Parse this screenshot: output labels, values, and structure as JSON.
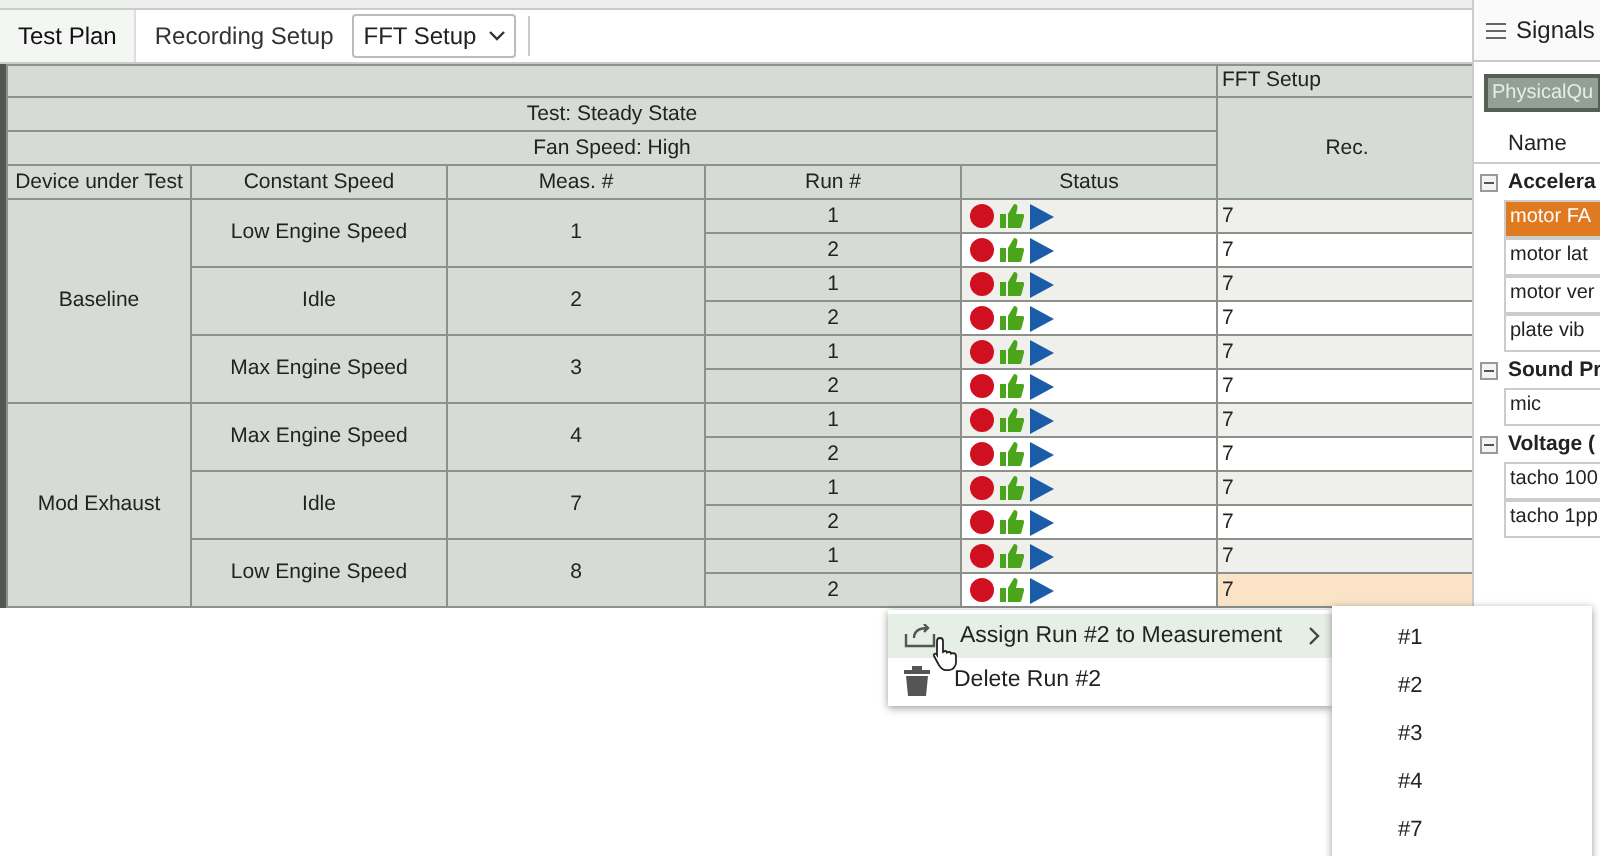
{
  "toolbar": {
    "tabs": [
      {
        "label": "Test Plan",
        "selected": true
      },
      {
        "label": "Recording Setup",
        "selected": false
      }
    ],
    "dropdown": {
      "value": "FFT Setup"
    }
  },
  "table": {
    "test_label": "Test: Steady State",
    "fan_label": "Fan Speed: High",
    "group_header": "FFT Setup",
    "rec_header": "Rec.",
    "columns": [
      "Device under Test",
      "Constant Speed",
      "Meas. #",
      "Run #",
      "Status"
    ],
    "devices": [
      {
        "name": "Baseline",
        "speeds": [
          {
            "name": "Low Engine Speed",
            "meas": "1",
            "runs": [
              {
                "run": "1",
                "rec": "7",
                "selected": false
              },
              {
                "run": "2",
                "rec": "7",
                "selected": false
              }
            ]
          },
          {
            "name": "Idle",
            "meas": "2",
            "runs": [
              {
                "run": "1",
                "rec": "7",
                "selected": false
              },
              {
                "run": "2",
                "rec": "7",
                "selected": false
              }
            ]
          },
          {
            "name": "Max Engine Speed",
            "meas": "3",
            "runs": [
              {
                "run": "1",
                "rec": "7",
                "selected": false
              },
              {
                "run": "2",
                "rec": "7",
                "selected": false
              }
            ]
          }
        ]
      },
      {
        "name": "Mod Exhaust",
        "speeds": [
          {
            "name": "Max Engine Speed",
            "meas": "4",
            "runs": [
              {
                "run": "1",
                "rec": "7",
                "selected": false
              },
              {
                "run": "2",
                "rec": "7",
                "selected": false
              }
            ]
          },
          {
            "name": "Idle",
            "meas": "7",
            "runs": [
              {
                "run": "1",
                "rec": "7",
                "selected": false
              },
              {
                "run": "2",
                "rec": "7",
                "selected": false
              }
            ]
          },
          {
            "name": "Low Engine Speed",
            "meas": "8",
            "runs": [
              {
                "run": "1",
                "rec": "7",
                "selected": false
              },
              {
                "run": "2",
                "rec": "7",
                "selected": true
              }
            ]
          }
        ]
      }
    ]
  },
  "context_menu": {
    "items": [
      {
        "kind": "assign",
        "label": "Assign Run #2 to Measurement",
        "highlighted": true
      },
      {
        "kind": "delete",
        "label": "Delete Run #2",
        "highlighted": false
      }
    ],
    "submenu": [
      "#1",
      "#2",
      "#3",
      "#4",
      "#7"
    ]
  },
  "signals": {
    "title": "Signals",
    "filter_button": "PhysicalQu",
    "column": "Name",
    "groups": [
      {
        "name": "Accelera",
        "expanded": true,
        "items": [
          {
            "name": "motor FA",
            "selected": true
          },
          {
            "name": "motor lat",
            "selected": false
          },
          {
            "name": "motor ver",
            "selected": false
          },
          {
            "name": "plate vib",
            "selected": false
          }
        ]
      },
      {
        "name": "Sound Pr",
        "expanded": true,
        "items": [
          {
            "name": "mic",
            "selected": false
          }
        ]
      },
      {
        "name": "Voltage (",
        "expanded": true,
        "items": [
          {
            "name": "tacho 100",
            "selected": false
          },
          {
            "name": "tacho 1pp",
            "selected": false
          }
        ]
      }
    ]
  }
}
